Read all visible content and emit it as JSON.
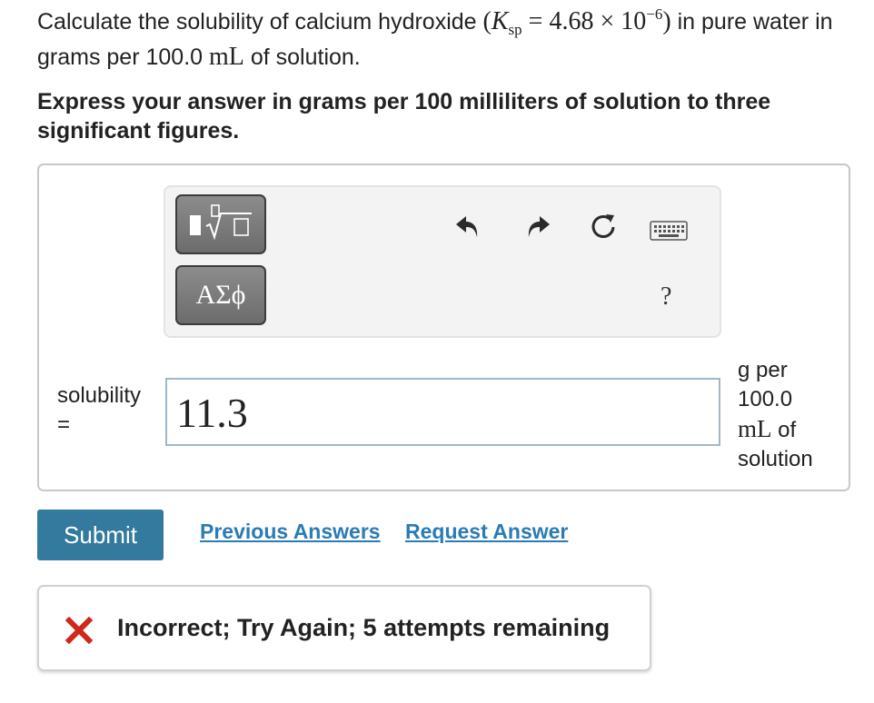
{
  "question": {
    "t1": "Calculate the solubility of calcium hydroxide ",
    "ksp_symbol": "K",
    "ksp_sub": "sp",
    "eq": " = 4.68 × 10",
    "exp": "−6",
    "t2": " in pure water in grams per 100.0 ",
    "mL": "mL",
    "t3": " of solution."
  },
  "instruction": "Express your answer in grams per 100 milliliters of solution to three significant figures.",
  "toolbar": {
    "greek_label": "ΑΣϕ",
    "help_label": "?",
    "icons": [
      "fraction-sqrt-icon",
      "undo-icon",
      "redo-icon",
      "reset-icon",
      "keyboard-icon"
    ]
  },
  "answer": {
    "label_line1": "solubility",
    "label_line2": "=",
    "value": "11.3",
    "unit_line1": "g per",
    "unit_line2": "100.0",
    "unit_line3_math": "mL",
    "unit_line3_text": " of",
    "unit_line4": "solution"
  },
  "actions": {
    "submit_label": "Submit",
    "previous_answers_label": "Previous Answers",
    "request_answer_label": "Request Answer"
  },
  "feedback": {
    "message": "Incorrect; Try Again; 5 attempts remaining",
    "status_color": "#d0271d"
  },
  "colors": {
    "accent": "#34799e",
    "link": "#2a7bb6"
  }
}
